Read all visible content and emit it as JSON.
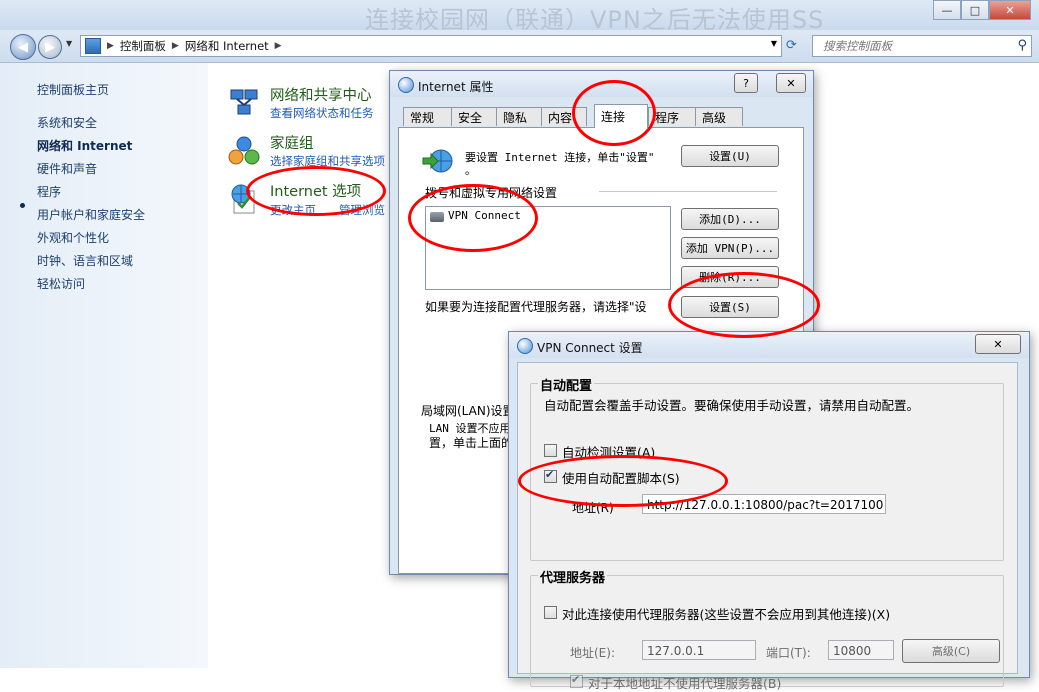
{
  "background_window": {
    "title_text": "连接校园网（联通）VPN之后无法使用SS"
  },
  "window_controls": {
    "minimize": "—",
    "maximize": "□",
    "close": "✕"
  },
  "address_bar": {
    "crumbs": [
      "控制面板",
      "网络和 Internet"
    ],
    "search_placeholder": "搜索控制面板"
  },
  "sidebar": {
    "items": [
      {
        "label": "控制面板主页"
      },
      {
        "label": "系统和安全"
      },
      {
        "label": "网络和 Internet"
      },
      {
        "label": "硬件和声音"
      },
      {
        "label": "程序"
      },
      {
        "label": "用户帐户和家庭安全"
      },
      {
        "label": "外观和个性化"
      },
      {
        "label": "时钟、语言和区域"
      },
      {
        "label": "轻松访问"
      }
    ]
  },
  "categories": [
    {
      "title": "网络和共享中心",
      "sub": "查看网络状态和任务"
    },
    {
      "title": "家庭组",
      "sub": "选择家庭组和共享选项"
    },
    {
      "title": "Internet 选项",
      "sub": "更改主页",
      "sub2": "管理浏览"
    }
  ],
  "internet_properties": {
    "title": "Internet 属性",
    "help_btn": "?",
    "close_btn": "✕",
    "tabs": [
      "常规",
      "安全",
      "隐私",
      "内容",
      "连接",
      "程序",
      "高级"
    ],
    "active_tab": "连接",
    "setup_text": "要设置 Internet 连接，单击\"设置\"",
    "setup_text_cont": "。",
    "setup_button": "设置(U)",
    "dialup_heading": "拨号和虚拟专用网络设置",
    "connections": [
      "VPN Connect"
    ],
    "add_button": "添加(D)...",
    "add_vpn_button": "添加 VPN(P)...",
    "remove_button": "删除(R)...",
    "proxy_prompt": "如果要为连接配置代理服务器，请选择\"设",
    "settings_button": "设置(S)",
    "lan_heading": "局域网(LAN)设置",
    "lan_text_1": "LAN 设置不应用",
    "lan_text_2": "置，单击上面的"
  },
  "vpn_dialog": {
    "title": "VPN Connect 设置",
    "close_btn": "✕",
    "auto_config": {
      "group_title": "自动配置",
      "description": "自动配置会覆盖手动设置。要确保使用手动设置，请禁用自动配置。",
      "auto_detect_label": "自动检测设置(A)",
      "auto_detect_checked": false,
      "use_script_label": "使用自动配置脚本(S)",
      "use_script_checked": true,
      "address_label": "地址(R)",
      "address_value": "http://127.0.0.1:10800/pac?t=2017100"
    },
    "proxy": {
      "group_title": "代理服务器",
      "use_proxy_label": "对此连接使用代理服务器(这些设置不会应用到其他连接)(X)",
      "use_proxy_checked": false,
      "address_label": "地址(E):",
      "address_value": "127.0.0.1",
      "port_label": "端口(T):",
      "port_value": "10800",
      "advanced_button": "高级(C)",
      "bypass_label": "对于本地地址不使用代理服务器(B)",
      "bypass_checked": true
    }
  },
  "annotation_color": "#ff0000",
  "colors": {
    "category_title": "#1e5e16",
    "link": "#1e5bb5",
    "sidebar_bg": "#e4edf7"
  }
}
